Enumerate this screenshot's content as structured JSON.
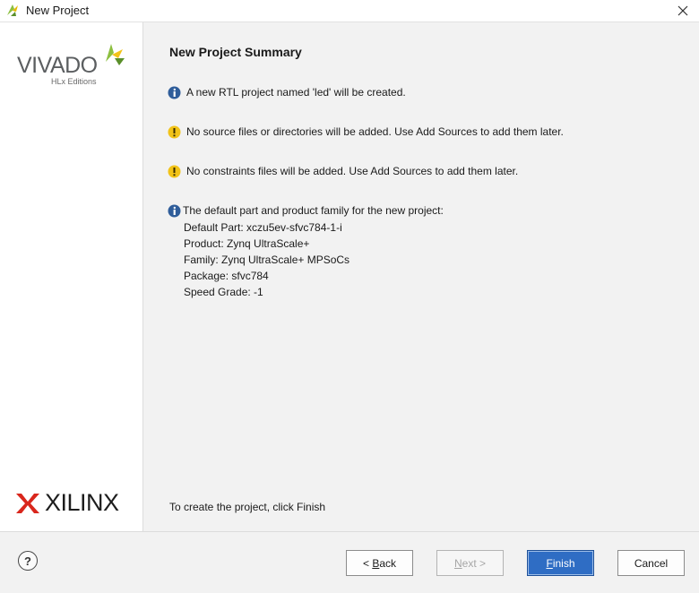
{
  "window": {
    "title": "New Project",
    "close_icon": "close-icon"
  },
  "sidebar": {
    "vivado_logo_text": "VIVADO",
    "vivado_logo_subtitle": "HLx Editions",
    "xilinx_logo_text": "XILINX"
  },
  "main": {
    "title": "New Project Summary",
    "messages": [
      {
        "icon": "info-icon",
        "text": "A new RTL project named 'led' will be created."
      },
      {
        "icon": "warning-icon",
        "text": "No source files or directories will be added. Use Add Sources to add them later."
      },
      {
        "icon": "warning-icon",
        "text": "No constraints files will be added. Use Add Sources to add them later."
      },
      {
        "icon": "info-icon",
        "text": "The default part and product family for the new project:"
      }
    ],
    "part_details": [
      "Default Part: xczu5ev-sfvc784-1-i",
      "Product: Zynq UltraScale+",
      "Family: Zynq UltraScale+ MPSoCs",
      "Package: sfvc784",
      "Speed Grade: -1"
    ],
    "footer": "To create the project, click Finish"
  },
  "buttons": {
    "help": "?",
    "back": {
      "prefix": "< ",
      "mnemonic": "B",
      "rest": "ack"
    },
    "next": {
      "mnemonic": "N",
      "rest": "ext >"
    },
    "finish": {
      "mnemonic": "F",
      "rest": "inish"
    },
    "cancel": "Cancel"
  },
  "colors": {
    "info": "#2f5d9a",
    "warning": "#f2c318",
    "primary_button": "#2f6dc4",
    "xilinx_red": "#d9261c",
    "vivado_green": "#8cbf3f"
  }
}
